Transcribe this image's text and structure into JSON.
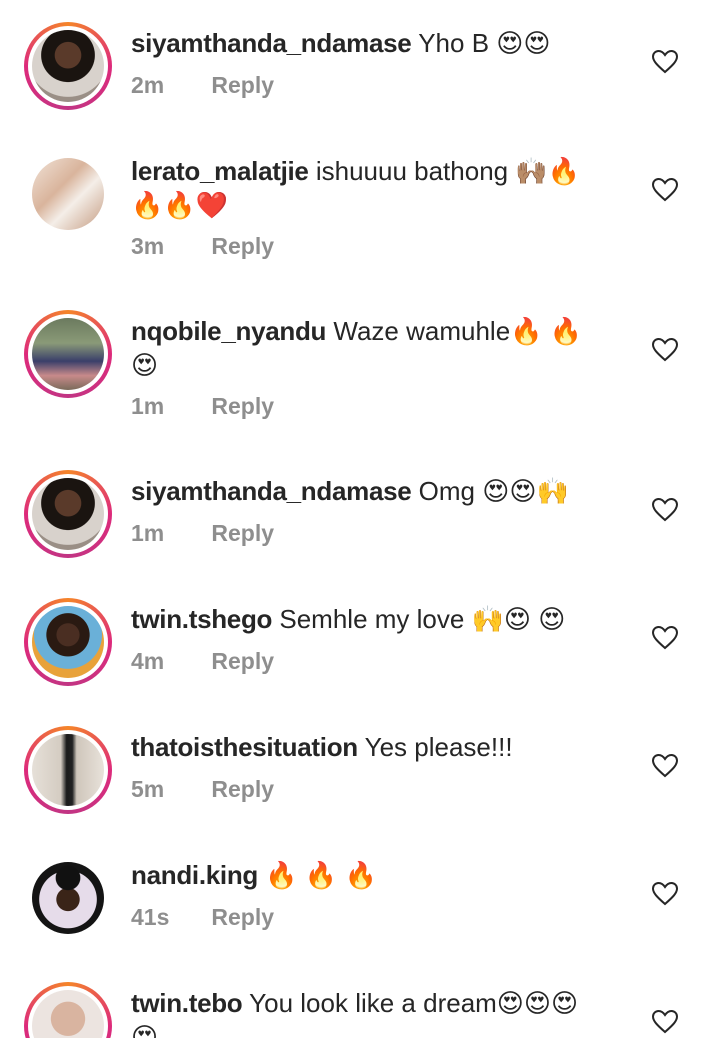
{
  "comments": [
    {
      "username": "siyamthanda_ndamase",
      "text": "Yho B 😍😍",
      "time": "2m",
      "reply_label": "Reply"
    },
    {
      "username": "lerato_malatjie",
      "text": "ishuuuu bathong 🙌🏽🔥",
      "text2": "🔥🔥❤️",
      "time": "3m",
      "reply_label": "Reply"
    },
    {
      "username": "nqobile_nyandu",
      "text": "Waze wamuhle🔥 🔥",
      "text2": "😍",
      "time": "1m",
      "reply_label": "Reply"
    },
    {
      "username": "siyamthanda_ndamase",
      "text": "Omg 😍😍🙌",
      "time": "1m",
      "reply_label": "Reply"
    },
    {
      "username": "twin.tshego",
      "text": "Semhle my love 🙌😍 😍",
      "time": "4m",
      "reply_label": "Reply"
    },
    {
      "username": "thatoisthesituation",
      "text": "Yes please!!!",
      "time": "5m",
      "reply_label": "Reply"
    },
    {
      "username": "nandi.king",
      "text": "🔥 🔥 🔥",
      "time": "41s",
      "reply_label": "Reply"
    },
    {
      "username": "twin.tebo",
      "text": "You look like a dream😍😍😍",
      "text2": "😍",
      "time": "",
      "reply_label": ""
    }
  ],
  "colors": {
    "text": "#262626",
    "muted": "#8e8e8e",
    "ring_start": "#f58529",
    "ring_end": "#dd2a7b"
  },
  "icons": {
    "like": "heart-outline-icon"
  }
}
